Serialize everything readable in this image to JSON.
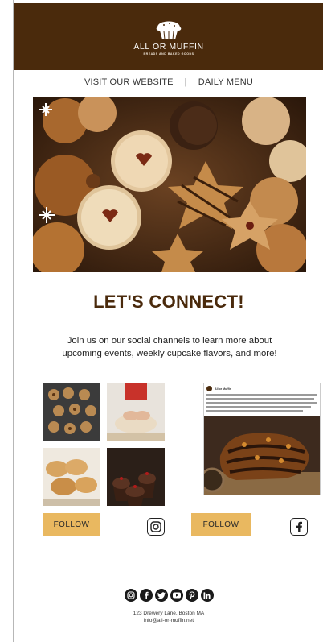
{
  "header": {
    "brand": "ALL OR MUFFIN",
    "tagline": "BREADS AND BAKED GOODS"
  },
  "nav": {
    "website": "VISIT OUR WEBSITE",
    "separator": "|",
    "menu": "DAILY MENU"
  },
  "main": {
    "title": "LET'S CONNECT!",
    "lead": "Join us on our social channels to learn more about upcoming events, weekly cupcake flavors, and more!"
  },
  "instagram": {
    "follow_label": "FOLLOW",
    "icon": "instagram-icon"
  },
  "facebook": {
    "follow_label": "FOLLOW",
    "icon": "facebook-icon",
    "post_author": "All or Muffin"
  },
  "footer": {
    "social_icons": [
      "instagram-icon",
      "facebook-icon",
      "twitter-icon",
      "youtube-icon",
      "pinterest-icon",
      "linkedin-icon"
    ],
    "address": "123 Drewery Lane, Boston MA",
    "email": "info@all-or-muffin.net"
  },
  "colors": {
    "brand_brown": "#4a2a0c",
    "button_gold": "#e9b860"
  }
}
